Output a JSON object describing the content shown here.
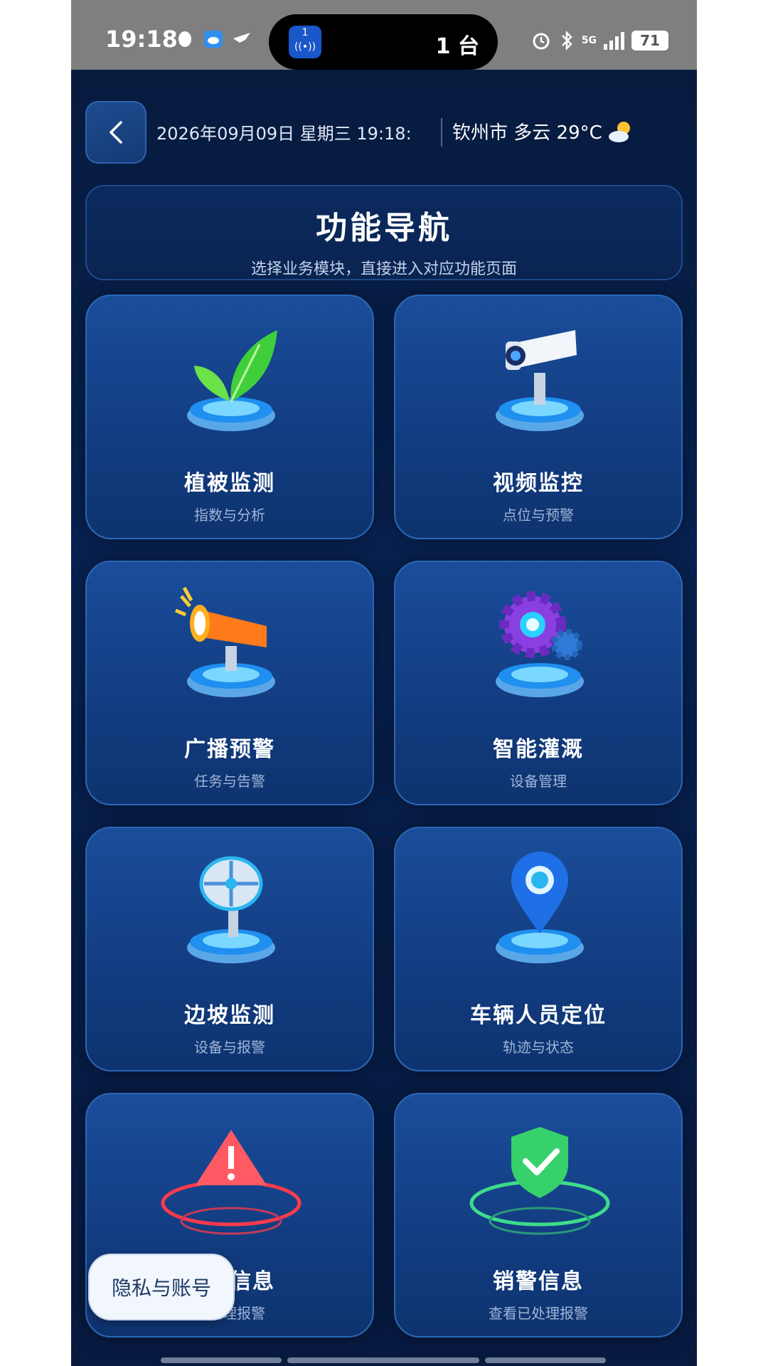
{
  "status_bar": {
    "time": "19:18",
    "island_app_badge": "1",
    "island_text": "1 台",
    "network": "5G",
    "battery": "71"
  },
  "header": {
    "datetime": "2026年09月09日 星期三 19:18:…",
    "weather": "钦州市 多云 29°C"
  },
  "title_card": {
    "title": "功能导航",
    "subtitle": "选择业务模块，直接进入对应功能页面"
  },
  "modules": [
    {
      "name": "植被监测",
      "desc": "指数与分析",
      "icon": "plant-icon"
    },
    {
      "name": "视频监控",
      "desc": "点位与预警",
      "icon": "camera-icon"
    },
    {
      "name": "广播预警",
      "desc": "任务与告警",
      "icon": "megaphone-icon"
    },
    {
      "name": "智能灌溉",
      "desc": "设备管理",
      "icon": "gear-icon"
    },
    {
      "name": "边坡监测",
      "desc": "设备与报警",
      "icon": "satellite-dish-icon"
    },
    {
      "name": "车辆人员定位",
      "desc": "轨迹与状态",
      "icon": "location-pin-icon"
    },
    {
      "name": "报警信息",
      "desc": "未处理报警",
      "icon": "warning-icon"
    },
    {
      "name": "销警信息",
      "desc": "查看已处理报警",
      "icon": "shield-check-icon"
    }
  ],
  "floating_button": {
    "label": "隐私与账号"
  },
  "colors": {
    "background": "#082150",
    "card": "#1a4d9b",
    "accent": "#2c67b5"
  }
}
